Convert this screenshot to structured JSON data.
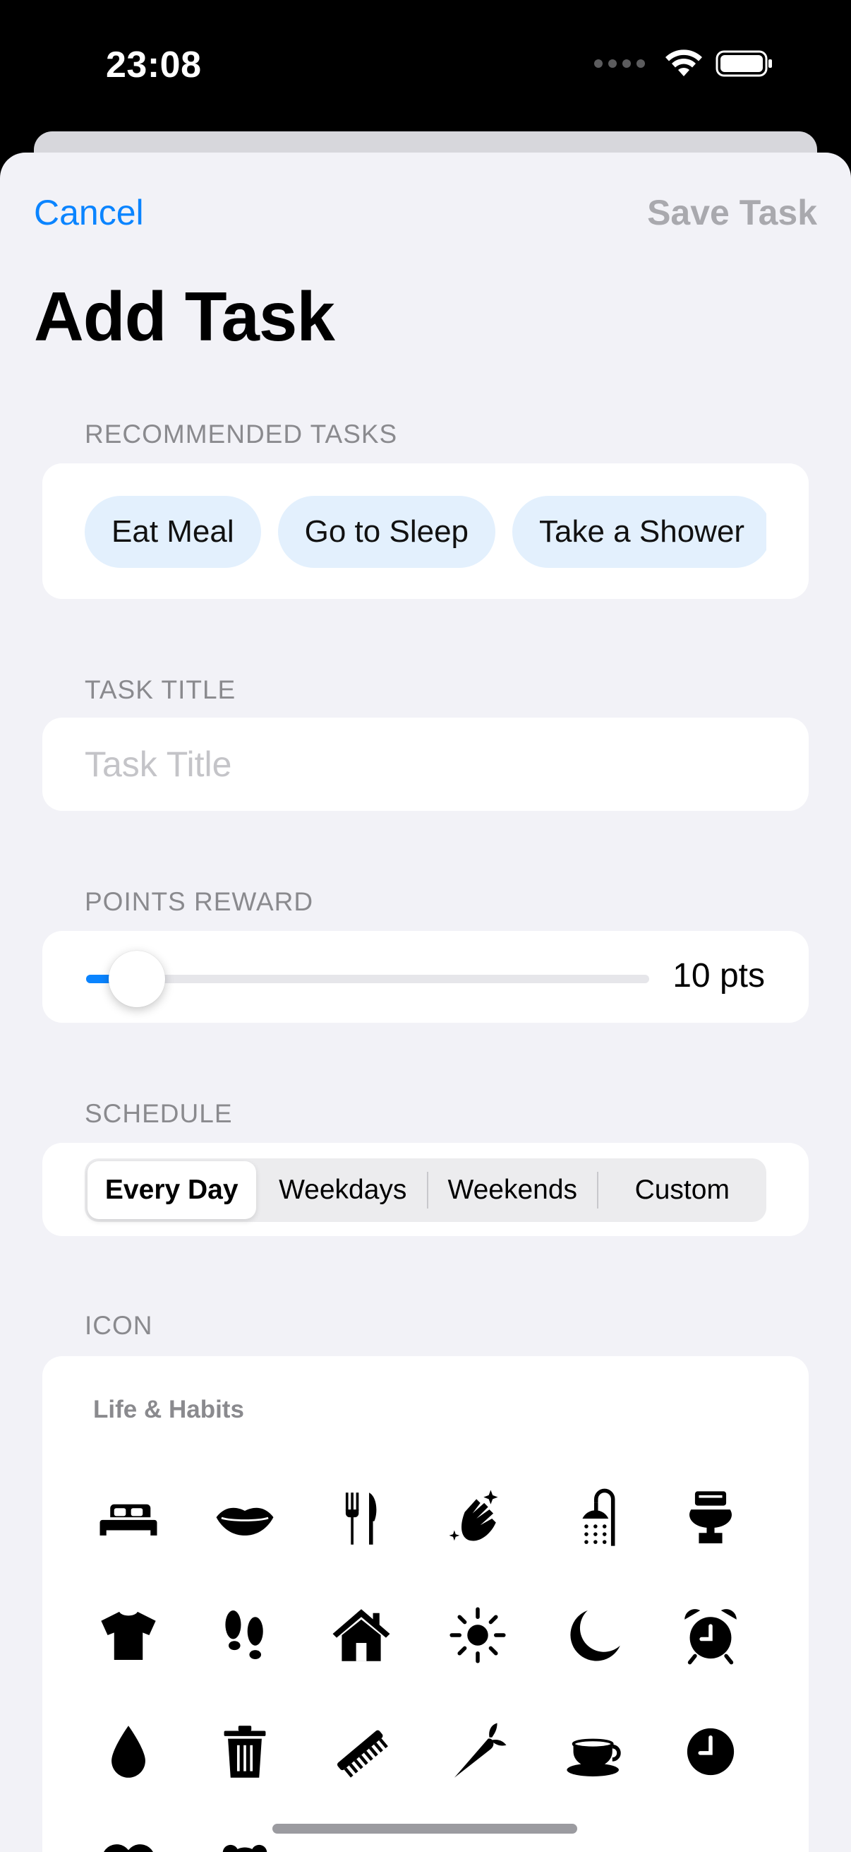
{
  "status": {
    "time": "23:08"
  },
  "nav": {
    "cancel": "Cancel",
    "save": "Save Task"
  },
  "page": {
    "title": "Add Task"
  },
  "recommended": {
    "label": "RECOMMENDED TASKS",
    "chips": [
      "Eat Meal",
      "Go to Sleep",
      "Take a Shower"
    ]
  },
  "task_title": {
    "label": "TASK TITLE",
    "placeholder": "Task Title",
    "value": ""
  },
  "points": {
    "label": "POINTS REWARD",
    "value_text": "10 pts",
    "fraction": 0.09
  },
  "schedule": {
    "label": "SCHEDULE",
    "options": [
      "Every Day",
      "Weekdays",
      "Weekends",
      "Custom"
    ],
    "selected": "Every Day"
  },
  "icon_section": {
    "label": "ICON",
    "group_title": "Life & Habits",
    "icons": [
      "bed-icon",
      "lips-icon",
      "fork-knife-icon",
      "hands-sparkles-icon",
      "shower-icon",
      "toilet-icon",
      "tshirt-icon",
      "footprints-icon",
      "house-icon",
      "sun-icon",
      "moon-icon",
      "alarm-clock-icon",
      "drop-icon",
      "trash-icon",
      "comb-icon",
      "carrot-icon",
      "cup-icon",
      "clock-icon",
      "heart-icon",
      "teddy-bear-icon"
    ]
  },
  "colors": {
    "accent": "#0a84ff",
    "background": "#f2f2f7",
    "chip": "#e3f0fd",
    "disabled": "#a9a9ae"
  }
}
